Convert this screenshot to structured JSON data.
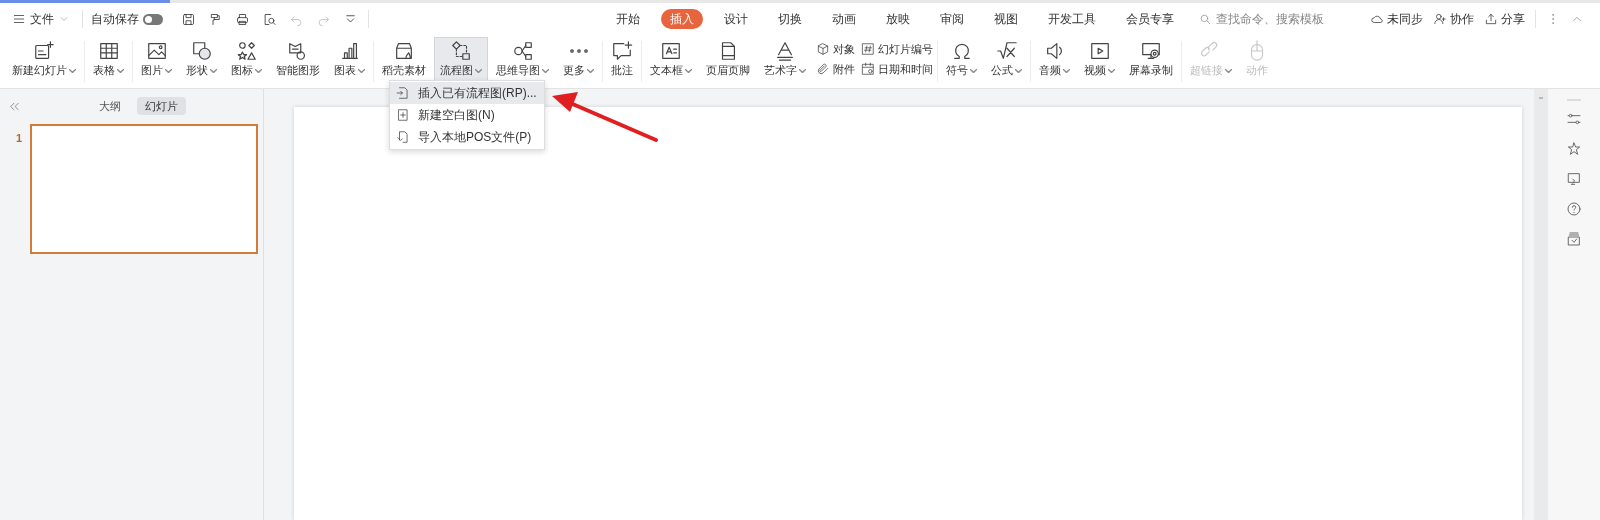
{
  "title_bar": {
    "file_menu": "文件",
    "autosave_label": "自动保存",
    "autosave_on": false,
    "tabs": [
      {
        "label": "开始",
        "selected": false
      },
      {
        "label": "插入",
        "selected": true
      },
      {
        "label": "设计",
        "selected": false
      },
      {
        "label": "切换",
        "selected": false
      },
      {
        "label": "动画",
        "selected": false
      },
      {
        "label": "放映",
        "selected": false
      },
      {
        "label": "审阅",
        "selected": false
      },
      {
        "label": "视图",
        "selected": false
      },
      {
        "label": "开发工具",
        "selected": false
      },
      {
        "label": "会员专享",
        "selected": false
      }
    ],
    "search": {
      "placeholder": "查找命令、搜索模板"
    },
    "actions": [
      "未同步",
      "协作",
      "分享"
    ]
  },
  "ribbon": {
    "groups": [
      [
        {
          "kind": "large",
          "label": "新建幻灯片",
          "dropdown": true,
          "open": false,
          "disabled": false
        }
      ],
      [
        {
          "kind": "large",
          "label": "表格",
          "dropdown": true,
          "open": false,
          "disabled": false
        }
      ],
      [
        {
          "kind": "large",
          "label": "图片",
          "dropdown": true,
          "open": false,
          "disabled": false
        },
        {
          "kind": "large",
          "label": "形状",
          "dropdown": true,
          "open": false,
          "disabled": false
        },
        {
          "kind": "large",
          "label": "图标",
          "dropdown": true,
          "open": false,
          "disabled": false
        },
        {
          "kind": "large",
          "label": "智能图形",
          "dropdown": false,
          "open": false,
          "disabled": false
        },
        {
          "kind": "large",
          "label": "图表",
          "dropdown": true,
          "open": false,
          "disabled": false
        }
      ],
      [
        {
          "kind": "large",
          "label": "稻壳素材",
          "dropdown": false,
          "open": false,
          "disabled": false
        },
        {
          "kind": "large",
          "label": "流程图",
          "dropdown": true,
          "open": true,
          "disabled": false
        },
        {
          "kind": "large",
          "label": "思维导图",
          "dropdown": true,
          "open": false,
          "disabled": false
        },
        {
          "kind": "large",
          "label": "更多",
          "dropdown": true,
          "open": false,
          "disabled": false
        }
      ],
      [
        {
          "kind": "large",
          "label": "批注",
          "dropdown": false,
          "open": false,
          "disabled": false
        }
      ],
      [
        {
          "kind": "large",
          "label": "文本框",
          "dropdown": true,
          "open": false,
          "disabled": false
        },
        {
          "kind": "large",
          "label": "页眉页脚",
          "dropdown": false,
          "open": false,
          "disabled": false
        },
        {
          "kind": "large",
          "label": "艺术字",
          "dropdown": true,
          "open": false,
          "disabled": false
        },
        {
          "kind": "stack",
          "items": [
            {
              "label": "对象"
            },
            {
              "label": "附件"
            }
          ]
        },
        {
          "kind": "stack",
          "items": [
            {
              "label": "幻灯片编号"
            },
            {
              "label": "日期和时间"
            }
          ]
        }
      ],
      [
        {
          "kind": "large",
          "label": "符号",
          "dropdown": true,
          "open": false,
          "disabled": false
        },
        {
          "kind": "large",
          "label": "公式",
          "dropdown": true,
          "open": false,
          "disabled": false
        }
      ],
      [
        {
          "kind": "large",
          "label": "音频",
          "dropdown": true,
          "open": false,
          "disabled": false
        },
        {
          "kind": "large",
          "label": "视频",
          "dropdown": true,
          "open": false,
          "disabled": false
        },
        {
          "kind": "large",
          "label": "屏幕录制",
          "dropdown": false,
          "open": false,
          "disabled": false
        }
      ],
      [
        {
          "kind": "large",
          "label": "超链接",
          "dropdown": true,
          "open": false,
          "disabled": true
        },
        {
          "kind": "large",
          "label": "动作",
          "dropdown": false,
          "open": false,
          "disabled": true
        }
      ]
    ]
  },
  "dropdown_menu": {
    "items": [
      {
        "label": "插入已有流程图(RP)...",
        "selected": true
      },
      {
        "label": "新建空白图(N)",
        "selected": false
      },
      {
        "label": "导入本地POS文件(P)",
        "selected": false
      }
    ]
  },
  "left_panel": {
    "tabs": [
      {
        "label": "大纲",
        "selected": false
      },
      {
        "label": "幻灯片",
        "selected": true
      }
    ],
    "slides": [
      {
        "number": "1",
        "selected": true
      }
    ]
  }
}
